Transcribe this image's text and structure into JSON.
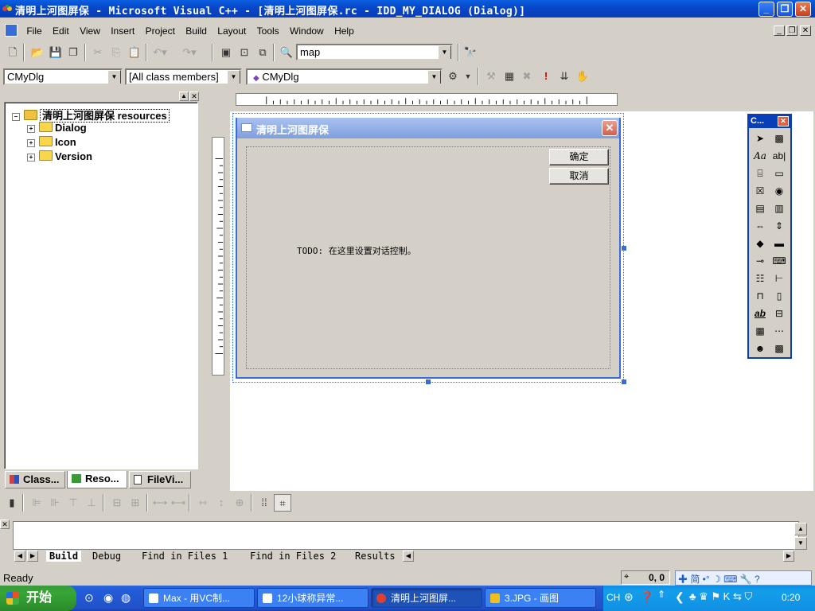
{
  "window": {
    "title": "清明上河图屏保 - Microsoft Visual C++ - [清明上河图屏保.rc - IDD_MY_DIALOG (Dialog)]",
    "minimize": "_",
    "maximize": "❐",
    "close": "✕"
  },
  "menubar": {
    "items": [
      "File",
      "Edit",
      "View",
      "Insert",
      "Project",
      "Build",
      "Layout",
      "Tools",
      "Window",
      "Help"
    ]
  },
  "toolbar1": {
    "find_combo_value": "map"
  },
  "toolbar2": {
    "class_combo": "CMyDlg",
    "filter_combo": "[All class members]",
    "member_combo": "CMyDlg"
  },
  "workspace": {
    "root_label": "清明上河图屏保 resources",
    "folders": [
      "Dialog",
      "Icon",
      "Version"
    ],
    "tabs": [
      "Class...",
      "Reso...",
      "FileVi..."
    ]
  },
  "dialog": {
    "title": "清明上河图屏保",
    "ok_label": "确定",
    "cancel_label": "取消",
    "todo_text": "TODO: 在这里设置对话控制。"
  },
  "palette": {
    "title": "C...",
    "close": "✕"
  },
  "output": {
    "tabs": [
      "Build",
      "Debug",
      "Find in Files 1",
      "Find in Files 2",
      "Results"
    ]
  },
  "status": {
    "text": "Ready",
    "coords": "0, 0"
  },
  "taskbar": {
    "start_label": "开始",
    "tasks": [
      "Max - 用VC制...",
      "12小球称异常...",
      "清明上河图屏...",
      "3.JPG - 画图"
    ],
    "lang": "CH",
    "clock": "0:20"
  }
}
